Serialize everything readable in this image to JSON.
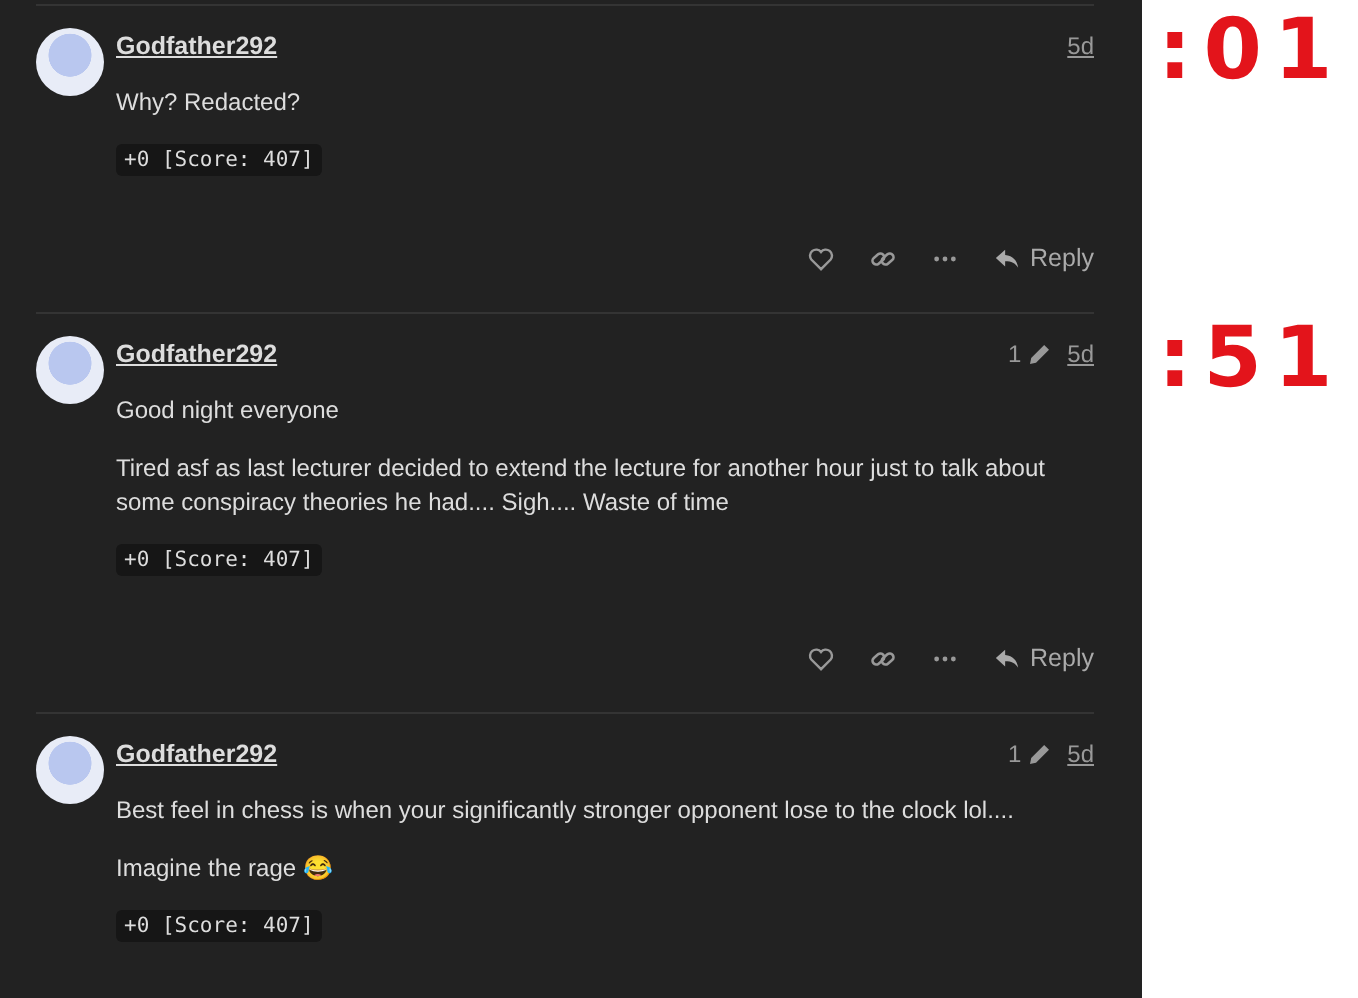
{
  "posts": [
    {
      "username": "Godfather292",
      "age": "5d",
      "paragraphs": [
        "Why? Redacted?"
      ],
      "score": "+0 [Score: 407]",
      "actions": {
        "reply": "Reply"
      }
    },
    {
      "username": "Godfather292",
      "edits": "1",
      "age": "5d",
      "paragraphs": [
        "Good night everyone",
        "Tired asf as last lecturer decided to extend the lecture for another hour just to talk about some conspiracy theories he had.... Sigh.... Waste of time"
      ],
      "score": "+0 [Score: 407]",
      "actions": {
        "reply": "Reply"
      }
    },
    {
      "username": "Godfather292",
      "edits": "1",
      "age": "5d",
      "paragraphs": [
        "Best feel in chess is when your significantly stronger opponent lose to the clock lol....",
        "Imagine the rage 😂"
      ],
      "score": "+0 [Score: 407]"
    }
  ],
  "annotations": [
    ":01",
    ":51"
  ]
}
